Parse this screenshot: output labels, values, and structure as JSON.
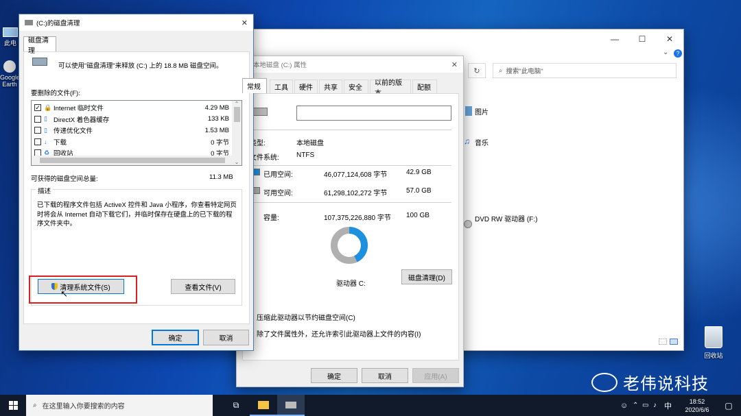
{
  "desktop": {
    "icons": [
      {
        "label": "此电"
      },
      {
        "label": "Google Earth"
      },
      {
        "label": "回收站"
      }
    ],
    "watermark": "老伟说科技"
  },
  "explorer": {
    "search_placeholder": "搜索\"此电脑\"",
    "items": [
      "图片",
      "音乐",
      "DVD RW 驱动器 (F:)"
    ]
  },
  "properties": {
    "title": "本地磁盘 (C:) 属性",
    "tabs": [
      "常规",
      "工具",
      "硬件",
      "共享",
      "安全",
      "以前的版本",
      "配额"
    ],
    "name_value": "",
    "type_label": "类型:",
    "type_value": "本地磁盘",
    "fs_label": "文件系统:",
    "fs_value": "NTFS",
    "used_label": "已用空间:",
    "used_bytes": "46,077,124,608 字节",
    "used_gb": "42.9 GB",
    "free_label": "可用空间:",
    "free_bytes": "61,298,102,272 字节",
    "free_gb": "57.0 GB",
    "cap_label": "容量:",
    "cap_bytes": "107,375,226,880 字节",
    "cap_gb": "100 GB",
    "drive_label": "驱动器 C:",
    "cleanup_button": "磁盘清理(D)",
    "compress_label": "压缩此驱动器以节约磁盘空间(C)",
    "index_label": "除了文件属性外，还允许索引此驱动器上文件的内容(I)",
    "ok": "确定",
    "cancel": "取消",
    "apply": "应用(A)",
    "used_fraction": 0.429,
    "used_color": "#1e90e0",
    "free_color": "#b0b0b0"
  },
  "cleanup": {
    "title": "(C:)的磁盘清理",
    "tab": "磁盘清理",
    "intro": "可以使用\"磁盘清理\"来释放  (C:) 上的 18.8 MB 磁盘空间。",
    "files_label": "要删除的文件(F):",
    "files": [
      {
        "checked": true,
        "name": "Internet 临时文件",
        "size": "4.29 MB",
        "icon": "lock-icon"
      },
      {
        "checked": false,
        "name": "DirectX 着色器缓存",
        "size": "133 KB",
        "icon": "file-icon"
      },
      {
        "checked": false,
        "name": "传递优化文件",
        "size": "1.53 MB",
        "icon": "file-icon"
      },
      {
        "checked": false,
        "name": "下载",
        "size": "0 字节",
        "icon": "download-icon"
      },
      {
        "checked": false,
        "name": "回收站",
        "size": "0 字节",
        "icon": "recycle-icon"
      }
    ],
    "total_label": "可获得的磁盘空间总量:",
    "total_value": "11.3 MB",
    "desc_label": "描述",
    "desc_text": "已下载的程序文件包括 ActiveX 控件和 Java 小程序，你查看特定网页时将会从 Internet 自动下载它们，并临时保存在硬盘上的已下载的程序文件夹中。",
    "clean_system_button": "清理系统文件(S)",
    "view_files_button": "查看文件(V)",
    "ok": "确定",
    "cancel": "取消"
  },
  "taskbar": {
    "search_placeholder": "在这里输入你要搜索的内容",
    "time": "18:52",
    "date": "2020/6/6",
    "ime": "中"
  }
}
